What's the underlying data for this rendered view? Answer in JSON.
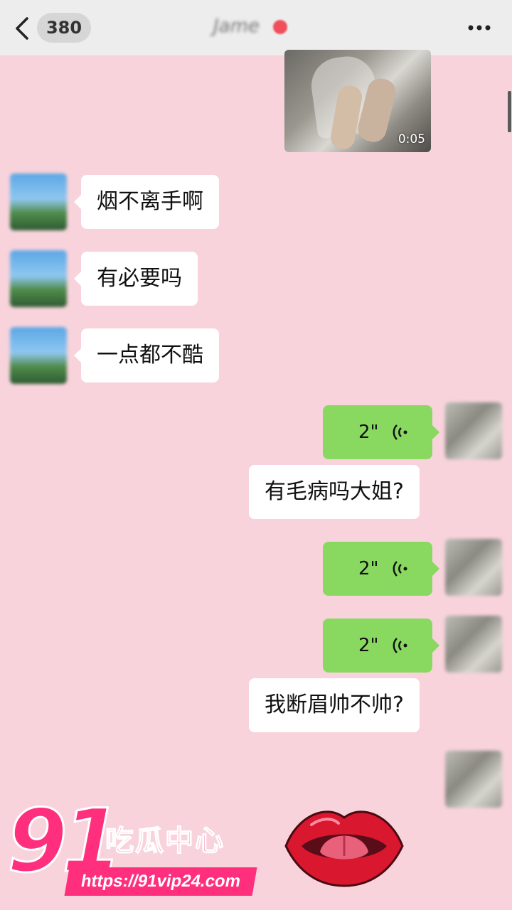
{
  "header": {
    "unread_count": "380",
    "contact_name": "Jame"
  },
  "video": {
    "duration": "0:05"
  },
  "messages": [
    {
      "side": "left",
      "kind": "text",
      "text": "烟不离手啊"
    },
    {
      "side": "left",
      "kind": "text",
      "text": "有必要吗"
    },
    {
      "side": "left",
      "kind": "text",
      "text": "一点都不酷"
    },
    {
      "side": "right",
      "kind": "voice",
      "duration": "2\""
    },
    {
      "side": "right",
      "kind": "text",
      "text": "有毛病吗大姐?"
    },
    {
      "side": "right",
      "kind": "voice",
      "duration": "2\""
    },
    {
      "side": "right",
      "kind": "voice",
      "duration": "2\""
    },
    {
      "side": "right",
      "kind": "text",
      "text": "我断眉帅不帅?"
    }
  ],
  "watermark": {
    "digits": "91",
    "name": "吃瓜中心",
    "url": "https://91vip24.com"
  },
  "colors": {
    "background": "#f8d3dc",
    "voice_bubble": "#89d961",
    "logo_pink": "#ff2f7d"
  }
}
